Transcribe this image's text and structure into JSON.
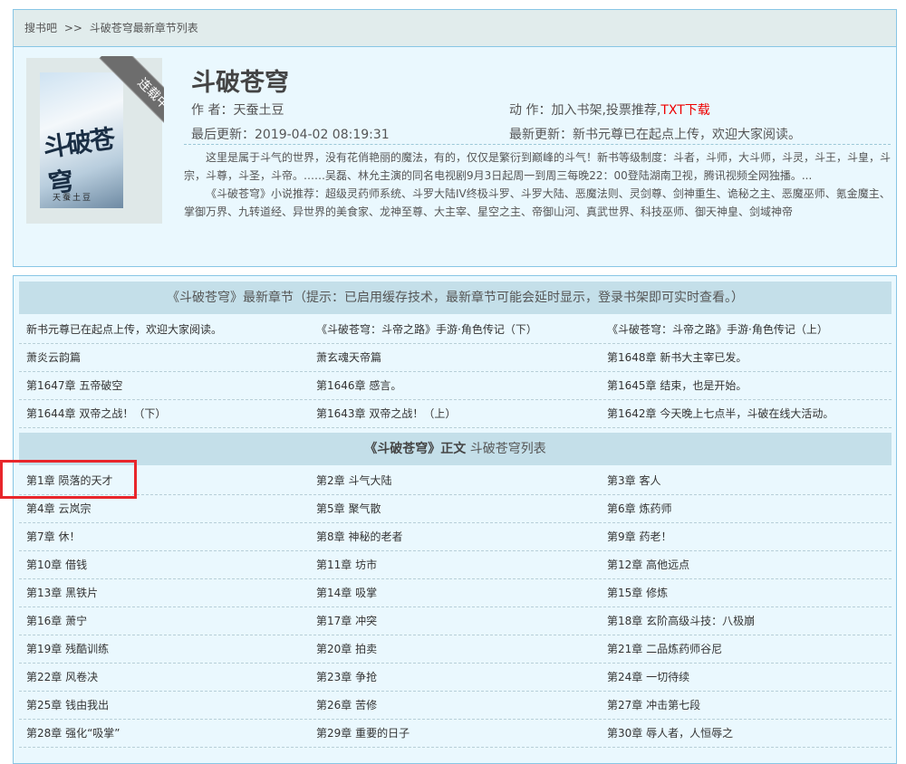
{
  "breadcrumb": {
    "site": "搜书吧",
    "sep": ">>",
    "page": "斗破苍穹最新章节列表"
  },
  "book": {
    "title": "斗破苍穹",
    "cover_title": "斗破苍穹",
    "cover_author": "天蚕土豆",
    "status_ribbon": "连载中",
    "author_label": "作 者：",
    "author": "天蚕土豆",
    "action_label": "动 作：",
    "action_shelf": "加入书架",
    "action_vote": "投票推荐",
    "action_download": "TXT下载",
    "updated_label": "最后更新：",
    "updated": "2019-04-02 08:19:31",
    "latest_label": "最新更新：",
    "latest": "新书元尊已在起点上传，欢迎大家阅读。",
    "intro1": "这里是属于斗气的世界，没有花俏艳丽的魔法，有的，仅仅是繁衍到巅峰的斗气！新书等级制度：斗者，斗师，大斗师，斗灵，斗王，斗皇，斗宗，斗尊，斗圣，斗帝。……吴磊、林允主演的同名电视剧9月3日起周一到周三每晚22：00登陆湖南卫视，腾讯视频全网独播。...",
    "intro2": "《斗破苍穹》小说推荐：超级灵药师系统、斗罗大陆IV终极斗罗、斗罗大陆、恶魔法则、灵剑尊、剑神重生、诡秘之主、恶魔巫师、氪金魔主、掌御万界、九转道经、异世界的美食家、龙神至尊、大主宰、星空之主、帝御山河、真武世界、科技巫师、御天神皇、剑域神帝"
  },
  "latest_section": {
    "heading": "《斗破苍穹》最新章节（提示：已启用缓存技术，最新章节可能会延时显示，登录书架即可实时查看。）",
    "rows": [
      [
        "新书元尊已在起点上传，欢迎大家阅读。",
        "《斗破苍穹：斗帝之路》手游·角色传记（下）",
        "《斗破苍穹：斗帝之路》手游·角色传记（上）"
      ],
      [
        "萧炎云韵篇",
        "萧玄魂天帝篇",
        "第1648章 新书大主宰已发。"
      ],
      [
        "第1647章 五帝破空",
        "第1646章 感言。",
        "第1645章 结束，也是开始。"
      ],
      [
        "第1644章 双帝之战！（下）",
        "第1643章 双帝之战！（上）",
        "第1642章 今天晚上七点半，斗破在线大活动。"
      ]
    ]
  },
  "main_section": {
    "heading_bold": "《斗破苍穹》正文",
    "heading_rest": " 斗破苍穹列表",
    "rows": [
      [
        "第1章 陨落的天才",
        "第2章 斗气大陆",
        "第3章 客人"
      ],
      [
        "第4章 云岚宗",
        "第5章 聚气散",
        "第6章 炼药师"
      ],
      [
        "第7章 休！",
        "第8章 神秘的老者",
        "第9章 药老！"
      ],
      [
        "第10章 借钱",
        "第11章 坊市",
        "第12章 高他远点"
      ],
      [
        "第13章 黑铁片",
        "第14章 吸掌",
        "第15章 修炼"
      ],
      [
        "第16章 萧宁",
        "第17章 冲突",
        "第18章 玄阶高级斗技：八极崩"
      ],
      [
        "第19章 残酷训练",
        "第20章 拍卖",
        "第21章 二品炼药师谷尼"
      ],
      [
        "第22章 风卷决",
        "第23章 争抢",
        "第24章 一切待续"
      ],
      [
        "第25章 钱由我出",
        "第26章 苦修",
        "第27章 冲击第七段"
      ],
      [
        "第28章 强化“吸掌”",
        "第29章 重要的日子",
        "第30章 辱人者，人恒辱之"
      ]
    ]
  },
  "colors": {
    "highlight": "#e8262b",
    "download": "#ee0000",
    "border": "#88c6e5",
    "panel": "#eaf8fe"
  }
}
